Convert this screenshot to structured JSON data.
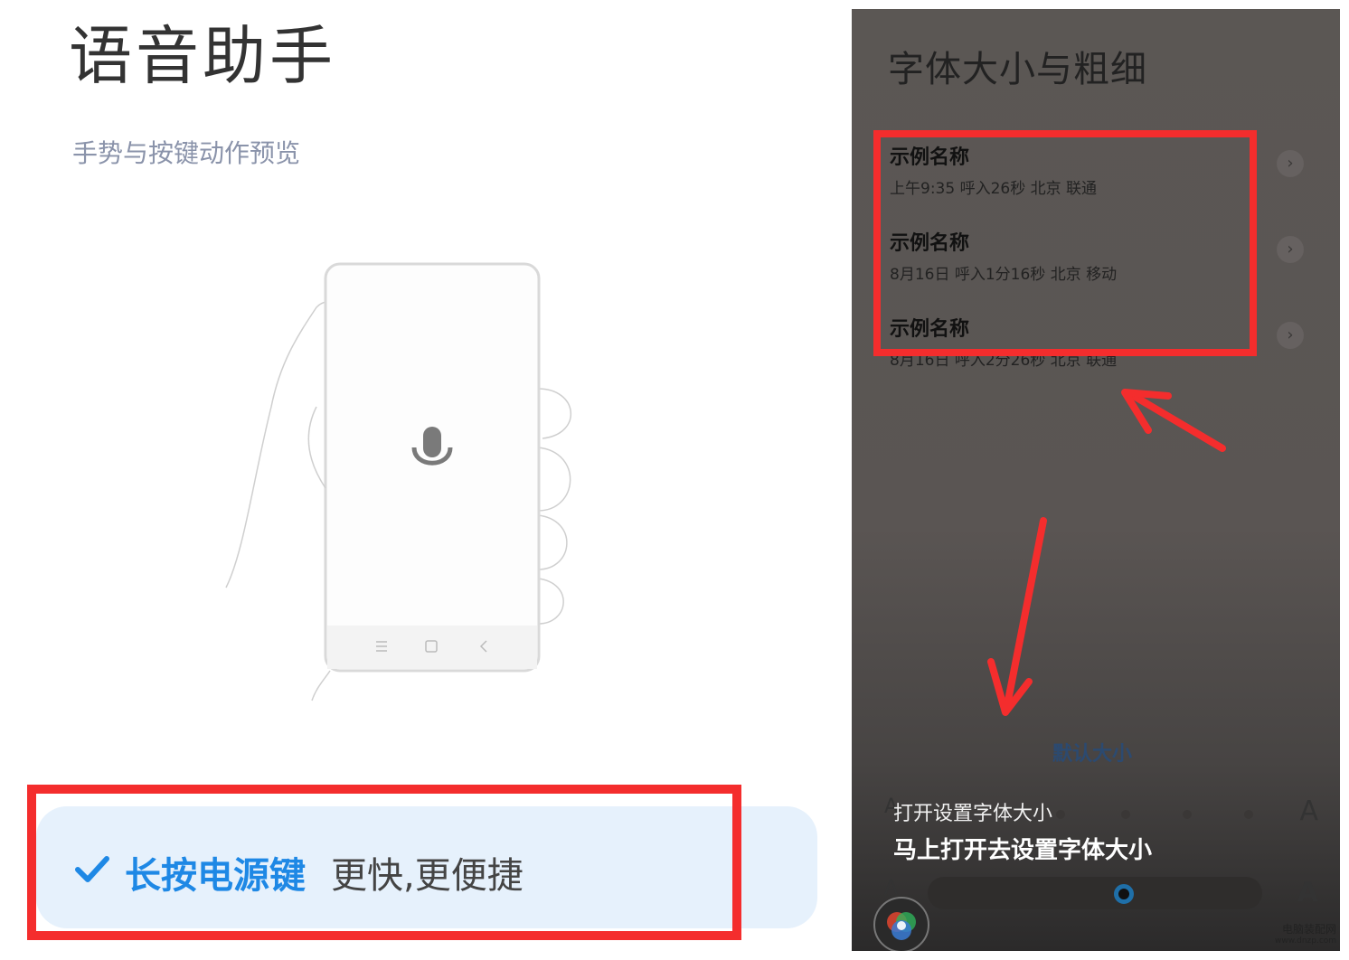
{
  "left": {
    "title": "语音助手",
    "subtitle": "手势与按键动作预览",
    "cta_primary": "长按电源键",
    "cta_secondary": "更快,更便捷"
  },
  "right": {
    "title": "字体大小与粗细",
    "contacts": [
      {
        "name": "示例名称",
        "meta": "上午9:35 呼入26秒 北京 联通"
      },
      {
        "name": "示例名称",
        "meta": "8月16日 呼入1分16秒 北京 移动"
      },
      {
        "name": "示例名称",
        "meta": "8月16日 呼入2分26秒 北京 联通"
      }
    ],
    "default_size": "默认大小",
    "small_a": "A",
    "large_a": "A",
    "assistant_query": "打开设置字体大小",
    "assistant_answer": "马上打开去设置字体大小"
  },
  "watermark": {
    "line1": "电脑装配网",
    "line2": "www.dnzp.com"
  },
  "colors": {
    "accent_blue": "#1e88e5",
    "highlight_red": "#f42d2d",
    "card_bg": "#e6f1fc"
  }
}
